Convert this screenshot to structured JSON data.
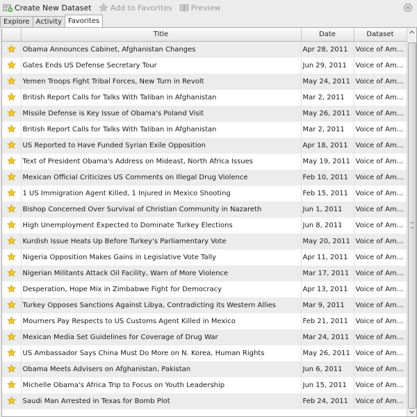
{
  "toolbar": {
    "create_label": "Create New Dataset",
    "favorites_label": "Add to Favorites",
    "preview_label": "Preview"
  },
  "tabs": [
    {
      "label": "Explore"
    },
    {
      "label": "Activity"
    },
    {
      "label": "Favorites"
    }
  ],
  "table": {
    "columns": [
      "Title",
      "Date",
      "Dataset"
    ],
    "rows": [
      {
        "title": "Obama Announces Cabinet, Afghanistan Changes",
        "date": "Apr 28, 2011",
        "dataset": "Voice of Americ..."
      },
      {
        "title": "Gates Ends US Defense Secretary Tour",
        "date": "Jun 29, 2011",
        "dataset": "Voice of Americ..."
      },
      {
        "title": "Yemen Troops Fight Tribal Forces, New Turn in Revolt",
        "date": "May 24, 2011",
        "dataset": "Voice of Americ..."
      },
      {
        "title": "British Report Calls for Talks With Taliban in Afghanistan",
        "date": "Mar 2, 2011",
        "dataset": "Voice of Americ..."
      },
      {
        "title": "Missile Defense is Key Issue of Obama's Poland Visit",
        "date": "May 26, 2011",
        "dataset": "Voice of Americ..."
      },
      {
        "title": "British Report Calls for Talks With Taliban in Afghanistan",
        "date": "Mar 2, 2011",
        "dataset": "Voice of Americ..."
      },
      {
        "title": "US Reported to Have Funded Syrian Exile Opposition",
        "date": "Apr 18, 2011",
        "dataset": "Voice of Americ..."
      },
      {
        "title": "Text of President Obama's Address on Mideast, North Africa Issues",
        "date": "May 19, 2011",
        "dataset": "Voice of Americ..."
      },
      {
        "title": "Mexican Official Criticizes US Comments on Illegal Drug Violence",
        "date": "Feb 10, 2011",
        "dataset": "Voice of Americ..."
      },
      {
        "title": "1 US Immigration Agent Killed, 1 Injured in Mexico Shooting",
        "date": "Feb 15, 2011",
        "dataset": "Voice of Americ..."
      },
      {
        "title": "Bishop Concerned Over Survival of Christian Community in Nazareth",
        "date": "Jun 1, 2011",
        "dataset": "Voice of Americ..."
      },
      {
        "title": "High Unemployment Expected to Dominate Turkey Elections",
        "date": "Jun 8, 2011",
        "dataset": "Voice of Americ..."
      },
      {
        "title": "Kurdish Issue Heats Up Before Turkey's Parliamentary Vote",
        "date": "May 20, 2011",
        "dataset": "Voice of Americ..."
      },
      {
        "title": "Nigeria Opposition Makes Gains in Legislative Vote Tally",
        "date": "Apr 11, 2011",
        "dataset": "Voice of Americ..."
      },
      {
        "title": "Nigerian Militants Attack Oil Facility, Warn of More Violence",
        "date": "Mar 17, 2011",
        "dataset": "Voice of Americ..."
      },
      {
        "title": "Desperation, Hope Mix in  Zimbabwe Fight for Democracy",
        "date": "Apr 13, 2011",
        "dataset": "Voice of Americ..."
      },
      {
        "title": "Turkey Opposes Sanctions Against Libya, Contradicting its Western Allies",
        "date": "Mar 9, 2011",
        "dataset": "Voice of Americ..."
      },
      {
        "title": "Mourners Pay Respects to US Customs Agent Killed in Mexico",
        "date": "Feb 21, 2011",
        "dataset": "Voice of Americ..."
      },
      {
        "title": "Mexican Media Set Guidelines for Coverage of Drug War",
        "date": "Mar 24, 2011",
        "dataset": "Voice of Americ..."
      },
      {
        "title": "US Ambassador Says China Must Do More on N. Korea, Human Rights",
        "date": "May 26, 2011",
        "dataset": "Voice of Americ..."
      },
      {
        "title": "Obama Meets Advisers on Afghanistan, Pakistan",
        "date": "Jun 6, 2011",
        "dataset": "Voice of Americ..."
      },
      {
        "title": "Michelle Obama's Africa Trip to Focus on Youth Leadership",
        "date": "Jun 15, 2011",
        "dataset": "Voice of Americ..."
      },
      {
        "title": "Saudi Man Arrested in Texas for Bomb Plot",
        "date": "Feb 24, 2011",
        "dataset": "Voice of Americ..."
      }
    ]
  },
  "colors": {
    "star_fill": "#f2c81c",
    "star_stroke": "#b88a00"
  }
}
